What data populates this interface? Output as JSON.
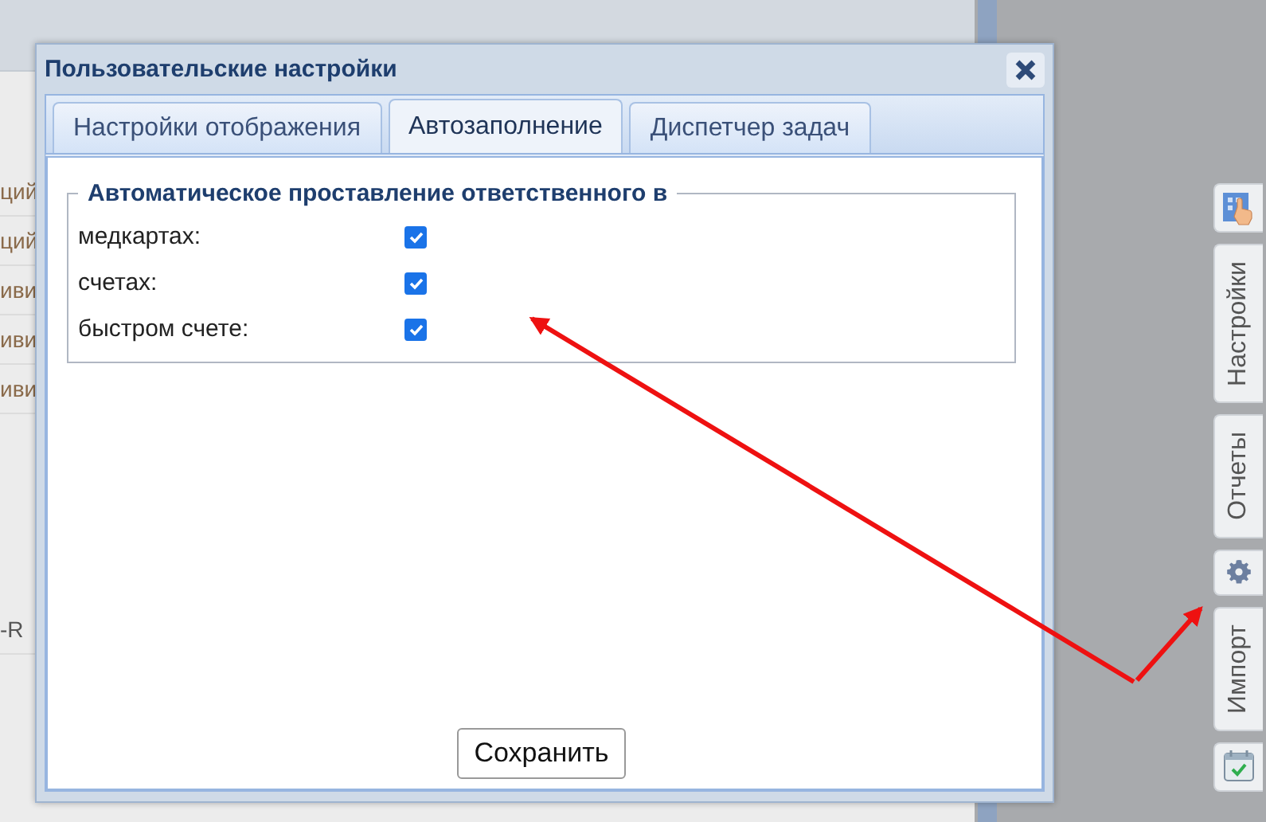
{
  "background_cells": [
    "ций",
    "ций",
    "иви",
    "иви",
    "иви",
    "-R"
  ],
  "window": {
    "title": "Пользовательские настройки"
  },
  "tabs": [
    {
      "label": "Настройки отображения",
      "selected": false
    },
    {
      "label": "Автозаполнение",
      "selected": true
    },
    {
      "label": "Диспетчер задач",
      "selected": false
    }
  ],
  "fieldset": {
    "legend": "Автоматическое проставление ответственного в",
    "rows": [
      {
        "label": "медкартах:",
        "checked": true
      },
      {
        "label": "счетах:",
        "checked": true
      },
      {
        "label": "быстром счете:",
        "checked": true
      }
    ]
  },
  "buttons": [
    "Сохранить"
  ],
  "side_tabs": [
    {
      "kind": "touch"
    },
    {
      "kind": "text",
      "label": "Настройки"
    },
    {
      "kind": "text",
      "label": "Отчеты"
    },
    {
      "kind": "gear"
    },
    {
      "kind": "text",
      "label": "Импорт"
    },
    {
      "kind": "calendar"
    }
  ]
}
